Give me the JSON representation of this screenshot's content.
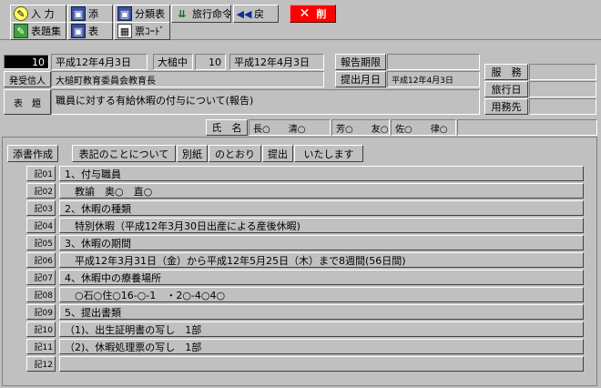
{
  "toolbar": {
    "input_label": "入 力",
    "add_label": "添",
    "classify_label": "分類表",
    "travel_label": "旅行命令",
    "back_label": "戻",
    "delete_label": "削",
    "header_edit_label": "表題集",
    "table_label": "表",
    "ticket_code_label": "票ｺｰﾄﾞ"
  },
  "header": {
    "doc_number": "10",
    "doc_date": "平成12年4月3日",
    "school": "大槌中",
    "school_number": "10",
    "school_date": "平成12年4月3日",
    "report_deadline_label": "報告期限",
    "report_deadline_value": "",
    "submit_date_label": "提出月日",
    "submit_date_value": "平成12年4月3日",
    "sender_label": "発受信人",
    "sender_value": "大槌町教育委員会教育長",
    "subject_label": "表　題",
    "subject_value": "職員に対する有給休暇の付与について(報告)",
    "service_label": "服　務",
    "service_value": "",
    "travel_date_label": "旅行日",
    "travel_date_value": "",
    "business_label": "用務先",
    "business_value": "",
    "name_label": "氏　名",
    "names": [
      "長○　　清○",
      "芳○　　友○",
      "佐○　　律○"
    ]
  },
  "phrases": {
    "attach": "添書作成",
    "items": [
      "表記のことについて",
      "別紙",
      "のとおり",
      "提出",
      "いたします"
    ]
  },
  "rows": [
    {
      "no": "記01",
      "text": "1、付与職員"
    },
    {
      "no": "記02",
      "text": "　教諭　奥○　直○"
    },
    {
      "no": "記03",
      "text": "2、休暇の種類"
    },
    {
      "no": "記04",
      "text": "　特別休暇（平成12年3月30日出産による産後休暇)"
    },
    {
      "no": "記05",
      "text": "3、休暇の期間"
    },
    {
      "no": "記06",
      "text": "　平成12年3月31日（金）から平成12年5月25日（木）まで8週間(56日間)"
    },
    {
      "no": "記07",
      "text": "4、休暇中の療養場所"
    },
    {
      "no": "記08",
      "text": "　○石○住○16-○-1　・2○-4○4○"
    },
    {
      "no": "記09",
      "text": "5、提出書類"
    },
    {
      "no": "記10",
      "text": "（1)、出生証明書の写し　1部"
    },
    {
      "no": "記11",
      "text": "（2)、休暇処理票の写し　1部"
    },
    {
      "no": "記12",
      "text": ""
    }
  ]
}
